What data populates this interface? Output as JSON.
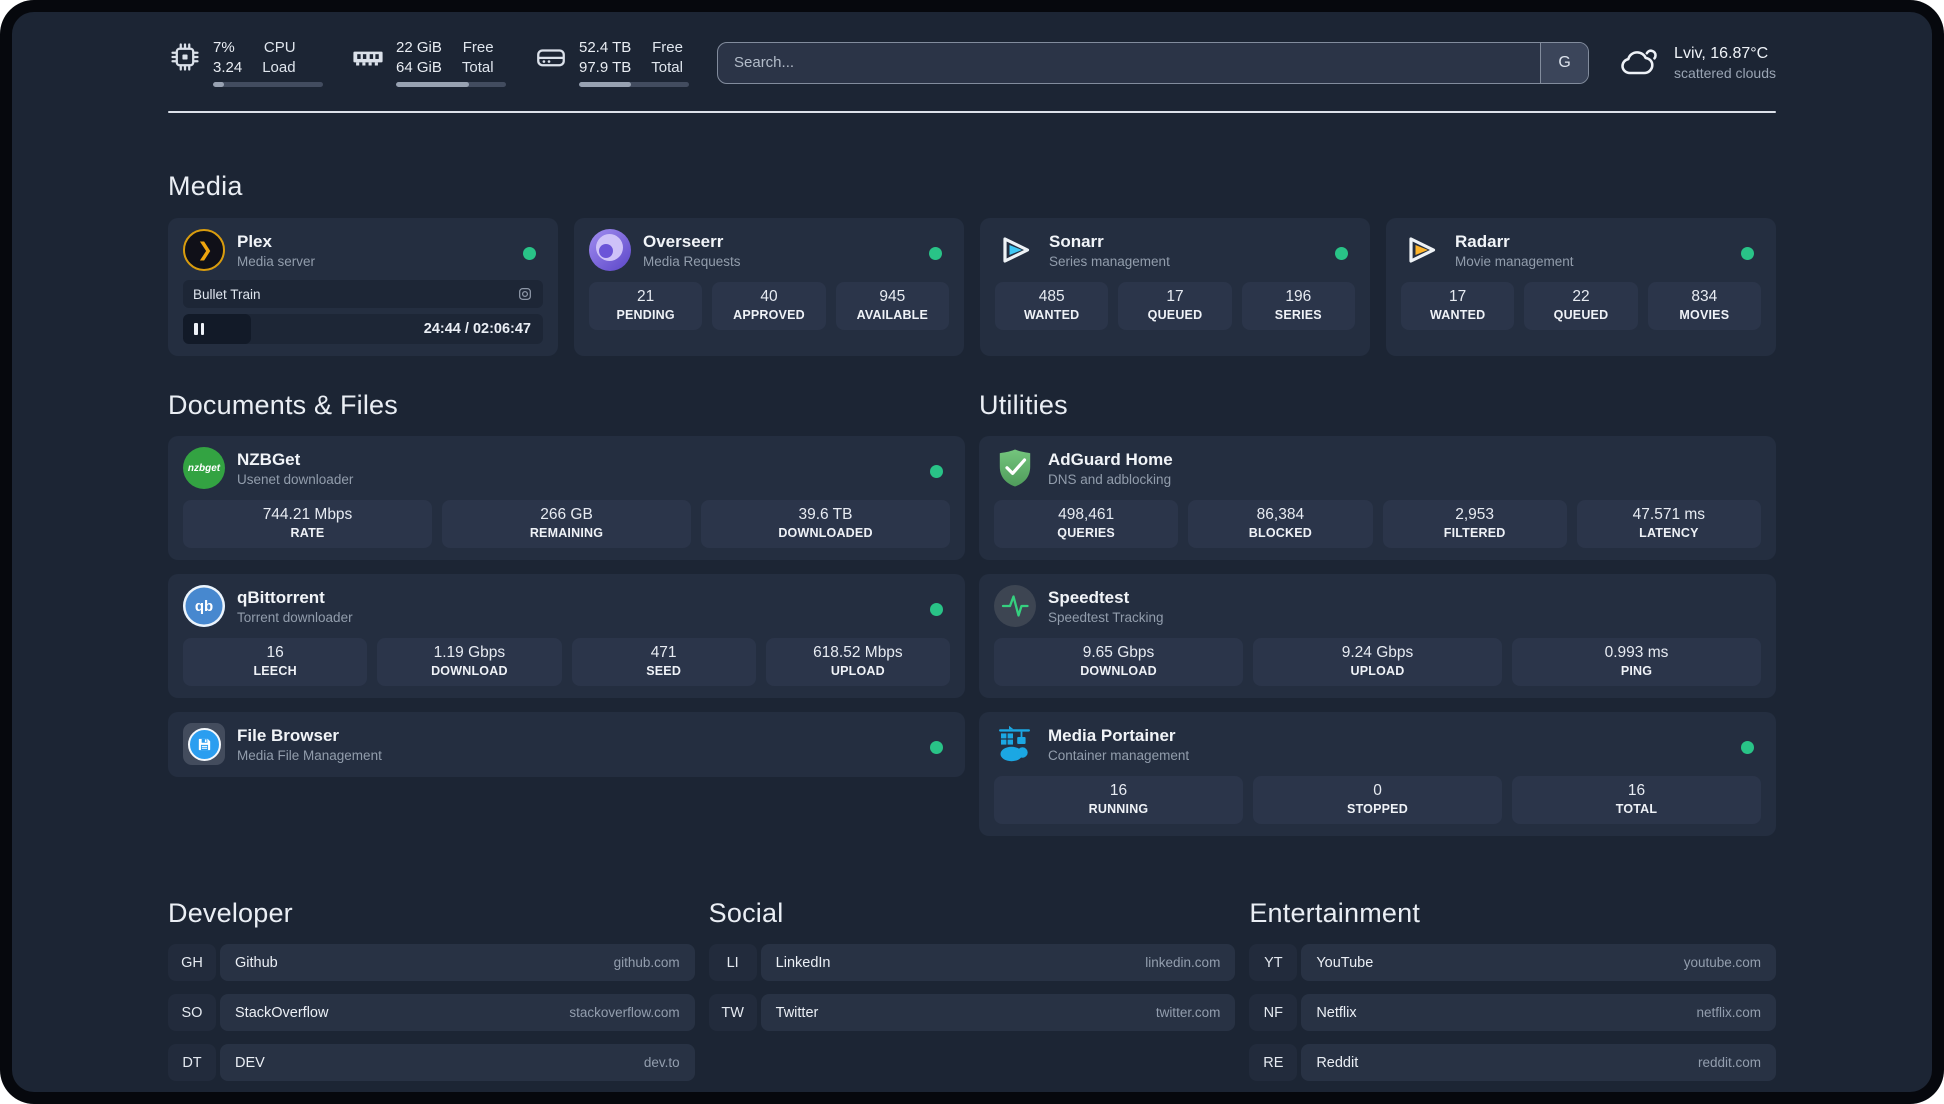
{
  "theme": {
    "status_dot_color": "#29c387",
    "background": "#1c2534",
    "card_background": "#242e40"
  },
  "header": {
    "resources": [
      {
        "icon": "cpu-icon",
        "values": [
          "7%",
          "3.24"
        ],
        "labels": [
          "CPU",
          "Load"
        ],
        "progress_percent": 10
      },
      {
        "icon": "memory-icon",
        "values": [
          "22 GiB",
          "64 GiB"
        ],
        "labels": [
          "Free",
          "Total"
        ],
        "progress_percent": 66
      },
      {
        "icon": "disk-icon",
        "values": [
          "52.4 TB",
          "97.9 TB"
        ],
        "labels": [
          "Free",
          "Total"
        ],
        "progress_percent": 47
      }
    ],
    "search": {
      "placeholder": "Search...",
      "engine_button": "G"
    },
    "weather": {
      "icon": "cloud-icon",
      "location_temp": "Lviv, 16.87°C",
      "condition": "scattered clouds"
    }
  },
  "sections": {
    "media": {
      "title": "Media",
      "services": [
        {
          "icon": "plex-icon",
          "icon_text": "❯",
          "name": "Plex",
          "description": "Media server",
          "online": true,
          "now_playing": {
            "title": "Bullet Train",
            "time": "24:44 / 02:06:47",
            "progress_percent": 19
          }
        },
        {
          "icon": "overseerr-icon",
          "name": "Overseerr",
          "description": "Media Requests",
          "online": true,
          "stats": [
            {
              "value": "21",
              "label": "PENDING"
            },
            {
              "value": "40",
              "label": "APPROVED"
            },
            {
              "value": "945",
              "label": "AVAILABLE"
            }
          ]
        },
        {
          "icon": "sonarr-icon",
          "name": "Sonarr",
          "description": "Series management",
          "online": true,
          "stats": [
            {
              "value": "485",
              "label": "WANTED"
            },
            {
              "value": "17",
              "label": "QUEUED"
            },
            {
              "value": "196",
              "label": "SERIES"
            }
          ]
        },
        {
          "icon": "radarr-icon",
          "name": "Radarr",
          "description": "Movie management",
          "online": true,
          "stats": [
            {
              "value": "17",
              "label": "WANTED"
            },
            {
              "value": "22",
              "label": "QUEUED"
            },
            {
              "value": "834",
              "label": "MOVIES"
            }
          ]
        }
      ]
    },
    "documents": {
      "title": "Documents & Files",
      "services": [
        {
          "icon": "nzbget-icon",
          "icon_text": "nzbget",
          "name": "NZBGet",
          "description": "Usenet downloader",
          "online": true,
          "stats": [
            {
              "value": "744.21 Mbps",
              "label": "RATE"
            },
            {
              "value": "266 GB",
              "label": "REMAINING"
            },
            {
              "value": "39.6 TB",
              "label": "DOWNLOADED"
            }
          ]
        },
        {
          "icon": "qbittorrent-icon",
          "icon_text": "qb",
          "name": "qBittorrent",
          "description": "Torrent downloader",
          "online": true,
          "stats": [
            {
              "value": "16",
              "label": "LEECH"
            },
            {
              "value": "1.19 Gbps",
              "label": "DOWNLOAD"
            },
            {
              "value": "471",
              "label": "SEED"
            },
            {
              "value": "618.52 Mbps",
              "label": "UPLOAD"
            }
          ]
        },
        {
          "icon": "filebrowser-icon",
          "name": "File Browser",
          "description": "Media File Management",
          "online": true
        }
      ]
    },
    "utilities": {
      "title": "Utilities",
      "services": [
        {
          "icon": "adguard-icon",
          "name": "AdGuard Home",
          "description": "DNS and adblocking",
          "online": false,
          "stats": [
            {
              "value": "498,461",
              "label": "QUERIES"
            },
            {
              "value": "86,384",
              "label": "BLOCKED"
            },
            {
              "value": "2,953",
              "label": "FILTERED"
            },
            {
              "value": "47.571 ms",
              "label": "LATENCY"
            }
          ]
        },
        {
          "icon": "speedtest-icon",
          "name": "Speedtest",
          "description": "Speedtest Tracking",
          "online": false,
          "stats": [
            {
              "value": "9.65 Gbps",
              "label": "DOWNLOAD"
            },
            {
              "value": "9.24 Gbps",
              "label": "UPLOAD"
            },
            {
              "value": "0.993 ms",
              "label": "PING"
            }
          ]
        },
        {
          "icon": "portainer-icon",
          "name": "Media Portainer",
          "description": "Container management",
          "online": true,
          "stats": [
            {
              "value": "16",
              "label": "RUNNING"
            },
            {
              "value": "0",
              "label": "STOPPED"
            },
            {
              "value": "16",
              "label": "TOTAL"
            }
          ]
        }
      ]
    },
    "bookmarks": [
      {
        "title": "Developer",
        "items": [
          {
            "abbr": "GH",
            "name": "Github",
            "domain": "github.com"
          },
          {
            "abbr": "SO",
            "name": "StackOverflow",
            "domain": "stackoverflow.com"
          },
          {
            "abbr": "DT",
            "name": "DEV",
            "domain": "dev.to"
          }
        ]
      },
      {
        "title": "Social",
        "items": [
          {
            "abbr": "LI",
            "name": "LinkedIn",
            "domain": "linkedin.com"
          },
          {
            "abbr": "TW",
            "name": "Twitter",
            "domain": "twitter.com"
          }
        ]
      },
      {
        "title": "Entertainment",
        "items": [
          {
            "abbr": "YT",
            "name": "YouTube",
            "domain": "youtube.com"
          },
          {
            "abbr": "NF",
            "name": "Netflix",
            "domain": "netflix.com"
          },
          {
            "abbr": "RE",
            "name": "Reddit",
            "domain": "reddit.com"
          }
        ]
      }
    ]
  }
}
